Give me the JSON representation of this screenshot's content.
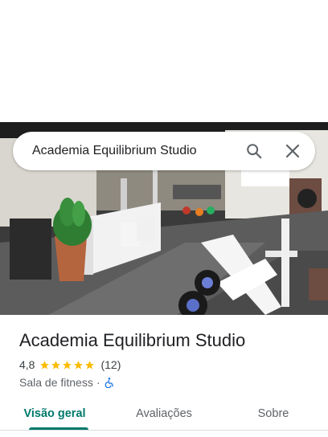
{
  "search": {
    "query": "Academia Equilibrium Studio",
    "search_icon": "search-icon",
    "close_icon": "close-icon"
  },
  "place": {
    "name": "Academia Equilibrium Studio",
    "rating": "4,8",
    "stars": 5,
    "reviews": "(12)",
    "category": "Sala de fitness",
    "separator": "·",
    "accessibility_icon": "wheelchair-icon",
    "star_color": "#fbbc04",
    "accessibility_color": "#1a73e8"
  },
  "tabs": [
    {
      "label": "Visão geral",
      "active": true
    },
    {
      "label": "Avaliações",
      "active": false
    },
    {
      "label": "Sobre",
      "active": false
    }
  ],
  "colors": {
    "accent": "#00796b"
  }
}
